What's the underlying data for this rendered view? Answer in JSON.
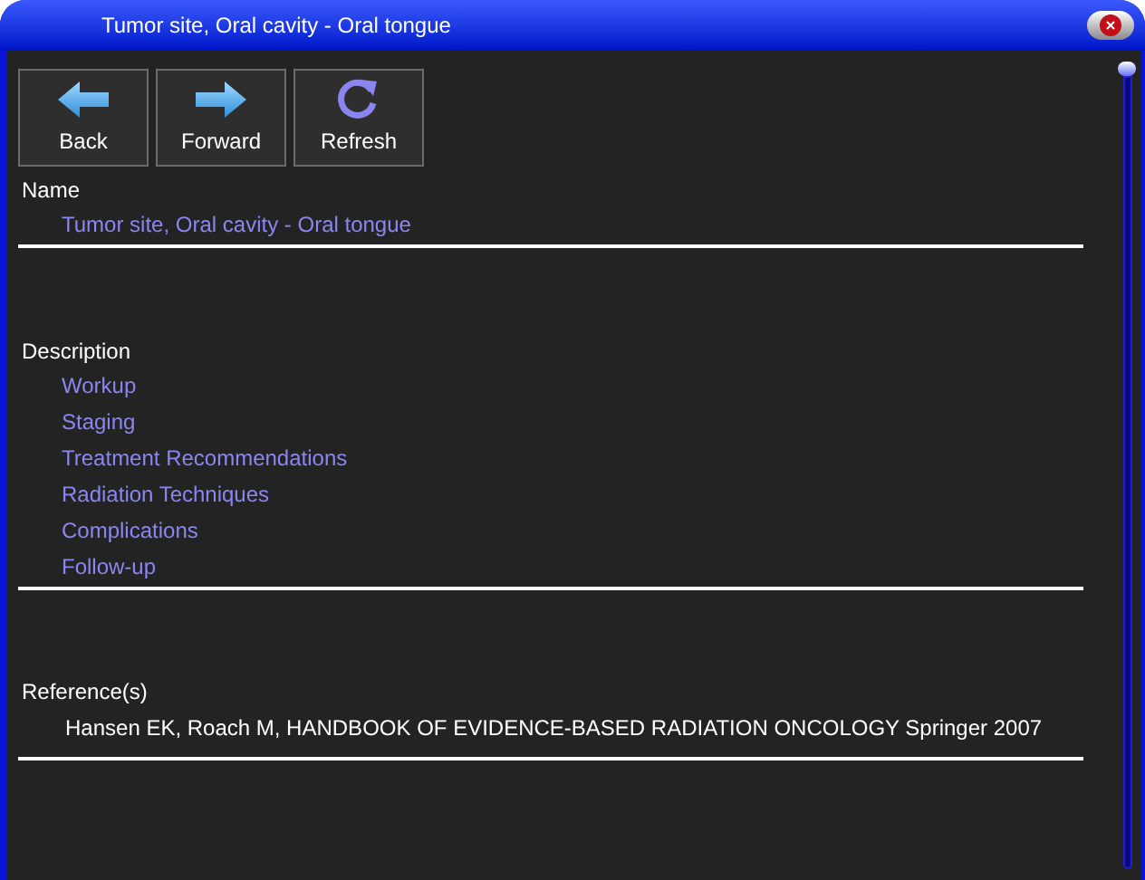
{
  "window": {
    "title": "Tumor site, Oral cavity - Oral tongue"
  },
  "toolbar": [
    {
      "kind": "back",
      "label": "Back"
    },
    {
      "kind": "forward",
      "label": "Forward"
    },
    {
      "kind": "refresh",
      "label": "Refresh"
    }
  ],
  "name": {
    "heading": "Name",
    "value": "Tumor site, Oral cavity - Oral tongue"
  },
  "description": {
    "heading": "Description",
    "links": [
      "Workup",
      "Staging",
      "Treatment Recommendations",
      "Radiation Techniques",
      "Complications",
      "Follow-up"
    ]
  },
  "references": {
    "heading": "Reference(s)",
    "text": "Hansen EK, Roach M, HANDBOOK OF EVIDENCE-BASED RADIATION ONCOLOGY Springer 2007"
  }
}
